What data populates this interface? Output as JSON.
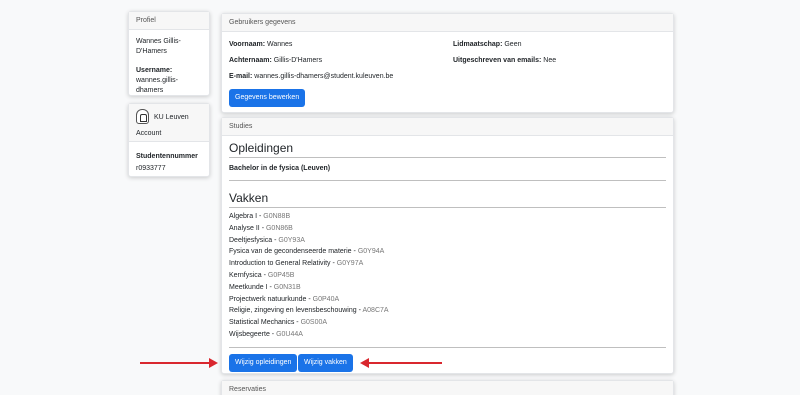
{
  "profile": {
    "header": "Profiel",
    "name": "Wannes Gillis-D'Hamers",
    "username_label": "Username:",
    "username": "wannes.gillis-dhamers"
  },
  "ku": {
    "name": "KU Leuven",
    "account": "Account",
    "student_number_label": "Studentennummer",
    "student_number": "r0933777"
  },
  "user_data": {
    "header": "Gebruikers gegevens",
    "first_name_label": "Voornaam:",
    "first_name": "Wannes",
    "last_name_label": "Achternaam:",
    "last_name": "Gillis-D'Hamers",
    "email_label": "E-mail:",
    "email": "wannes.gillis-dhamers@student.kuleuven.be",
    "membership_label": "Lidmaatschap:",
    "membership": "Geen",
    "unsubscribed_label": "Uitgeschreven van emails:",
    "unsubscribed": "Nee",
    "edit_button": "Gegevens bewerken"
  },
  "studies": {
    "header": "Studies",
    "opleidingen_title": "Opleidingen",
    "opleidingen": [
      "Bachelor in de fysica (Leuven)"
    ],
    "vakken_title": "Vakken",
    "courses": [
      {
        "name": "Algebra I",
        "code": "G0N88B"
      },
      {
        "name": "Analyse II",
        "code": "G0N86B"
      },
      {
        "name": "Deeltjesfysica",
        "code": "G0Y93A"
      },
      {
        "name": "Fysica van de gecondenseerde materie",
        "code": "G0Y94A"
      },
      {
        "name": "Introduction to General Relativity",
        "code": "G0Y97A"
      },
      {
        "name": "Kernfysica",
        "code": "G0P45B"
      },
      {
        "name": "Meetkunde I",
        "code": "G0N31B"
      },
      {
        "name": "Projectwerk natuurkunde",
        "code": "G0P40A"
      },
      {
        "name": "Religie, zingeving en levensbeschouwing",
        "code": "A08C7A"
      },
      {
        "name": "Statistical Mechanics",
        "code": "G0S00A"
      },
      {
        "name": "Wijsbegeerte",
        "code": "G0U44A"
      }
    ],
    "separator": " - ",
    "edit_opleidingen_button": "Wijzig opleidingen",
    "edit_vakken_button": "Wijzig vakken"
  },
  "reservations": {
    "header": "Reservaties"
  },
  "colors": {
    "primary": "#1a73e8",
    "arrow": "#d9272e"
  }
}
